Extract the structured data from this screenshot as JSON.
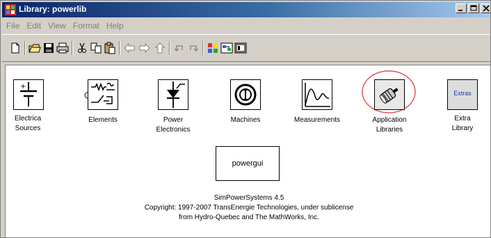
{
  "window": {
    "title": "Library: powerlib"
  },
  "menu": {
    "items": [
      "File",
      "Edit",
      "View",
      "Format",
      "Help"
    ]
  },
  "toolbar": {
    "icons": [
      "new-icon",
      "open-icon",
      "save-icon",
      "print-icon",
      "cut-icon",
      "copy-icon",
      "paste-icon",
      "back-icon",
      "forward-icon",
      "up-icon",
      "undo-icon",
      "redo-icon",
      "library-browser-icon",
      "model-browser-icon",
      "debugger-icon"
    ]
  },
  "blocks": {
    "electrical_sources": {
      "line1": "Electrica",
      "line2": "Sources"
    },
    "elements": {
      "line1": "Elements"
    },
    "power_electronics": {
      "line1": "Power",
      "line2": "Electronics"
    },
    "machines": {
      "line1": "Machines"
    },
    "measurements": {
      "line1": "Measurements"
    },
    "application_libraries": {
      "line1": "Application",
      "line2": "Libraries"
    },
    "extra_library": {
      "icon_text": "Extras",
      "line1": "Extra",
      "line2": "Library"
    }
  },
  "powergui": {
    "label": "powergui"
  },
  "info": {
    "line1": "SimPowerSystems 4.5",
    "line2": "Copyright:  1997-2007 TransEnergie Technologies, under sublicense",
    "line3": "from Hydro-Quebec and The MathWorks, Inc."
  },
  "colors": {
    "titlebar_start": "#0a246a",
    "titlebar_end": "#a6caf0",
    "highlight_circle": "#e05050",
    "window_face": "#d4d0c8"
  }
}
